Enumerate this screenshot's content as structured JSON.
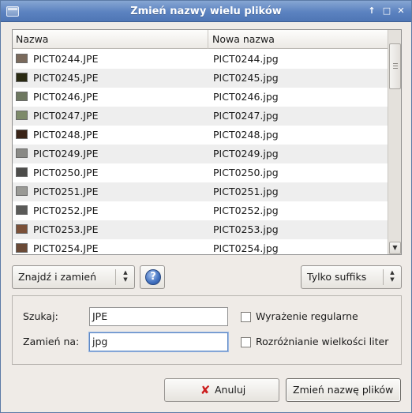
{
  "window": {
    "title": "Zmień nazwy wielu plików",
    "buttons": [
      "↑",
      "□",
      "✕"
    ]
  },
  "list": {
    "columns": [
      "Nazwa",
      "Nowa nazwa"
    ],
    "rows": [
      {
        "name": "PICT0244.JPE",
        "new_name": "PICT0244.jpg",
        "thumb": "#7a6a5c"
      },
      {
        "name": "PICT0245.JPE",
        "new_name": "PICT0245.jpg",
        "thumb": "#2a2a12"
      },
      {
        "name": "PICT0246.JPE",
        "new_name": "PICT0246.jpg",
        "thumb": "#6e7860"
      },
      {
        "name": "PICT0247.JPE",
        "new_name": "PICT0247.jpg",
        "thumb": "#7d8a6a"
      },
      {
        "name": "PICT0248.JPE",
        "new_name": "PICT0248.jpg",
        "thumb": "#3a2418"
      },
      {
        "name": "PICT0249.JPE",
        "new_name": "PICT0249.jpg",
        "thumb": "#8a8a86"
      },
      {
        "name": "PICT0250.JPE",
        "new_name": "PICT0250.jpg",
        "thumb": "#4c4c4a"
      },
      {
        "name": "PICT0251.JPE",
        "new_name": "PICT0251.jpg",
        "thumb": "#9a9a96"
      },
      {
        "name": "PICT0252.JPE",
        "new_name": "PICT0252.jpg",
        "thumb": "#5a5a58"
      },
      {
        "name": "PICT0253.JPE",
        "new_name": "PICT0253.jpg",
        "thumb": "#7a5038"
      },
      {
        "name": "PICT0254.JPE",
        "new_name": "PICT0254.jpg",
        "thumb": "#6a4a36"
      }
    ]
  },
  "mode_select": {
    "value": "Znajdź i zamień"
  },
  "suffix_select": {
    "value": "Tylko suffiks"
  },
  "search": {
    "label": "Szukaj:",
    "value": "JPE"
  },
  "replace": {
    "label": "Zamień na:",
    "value": "jpg"
  },
  "options": {
    "regex": {
      "label": "Wyrażenie regularne",
      "checked": false
    },
    "case_sensitive": {
      "label": "Rozróżnianie wielkości liter",
      "checked": false
    }
  },
  "actions": {
    "cancel": "Anuluj",
    "rename": "Zmień nazwę plików"
  }
}
